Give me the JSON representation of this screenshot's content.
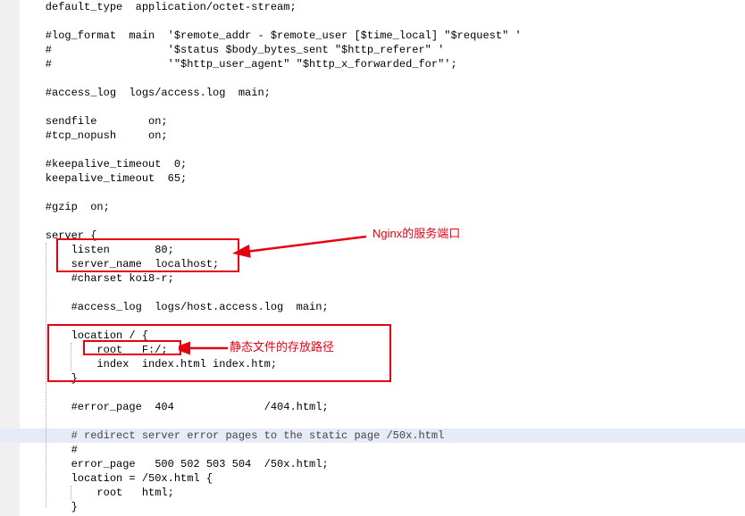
{
  "lines": {
    "l0": "    default_type  application/octet-stream;",
    "l1": "",
    "l2": "    #log_format  main  '$remote_addr - $remote_user [$time_local] \"$request\" '",
    "l3": "    #                  '$status $body_bytes_sent \"$http_referer\" '",
    "l4": "    #                  '\"$http_user_agent\" \"$http_x_forwarded_for\"';",
    "l5": "",
    "l6": "    #access_log  logs/access.log  main;",
    "l7": "",
    "l8": "    sendfile        on;",
    "l9": "    #tcp_nopush     on;",
    "l10": "",
    "l11": "    #keepalive_timeout  0;",
    "l12": "    keepalive_timeout  65;",
    "l13": "",
    "l14": "    #gzip  on;",
    "l15": "",
    "l16": "    server {",
    "l17": "        listen       80;",
    "l18": "        server_name  localhost;",
    "l19": "        #charset koi8-r;",
    "l20": "",
    "l21": "        #access_log  logs/host.access.log  main;",
    "l22": "",
    "l23": "        location / {",
    "l24": "            root   F:/;",
    "l25": "            index  index.html index.htm;",
    "l26": "        }",
    "l27": "",
    "l28": "        #error_page  404              /404.html;",
    "l29": "",
    "l30": "        # redirect server error pages to the static page /50x.html",
    "l31": "        #",
    "l32": "        error_page   500 502 503 504  /50x.html;",
    "l33": "        location = /50x.html {",
    "l34": "            root   html;",
    "l35": "        }"
  },
  "annotations": {
    "a1": "Nginx的服务端口",
    "a2": "静态文件的存放路径"
  }
}
